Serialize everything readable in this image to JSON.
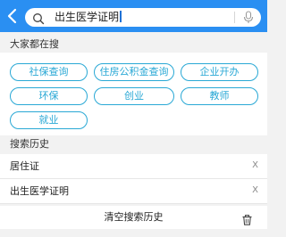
{
  "search": {
    "value": "出生医学证明",
    "back_icon": "chevron-left-icon",
    "search_icon": "search-icon",
    "mic_icon": "microphone-icon"
  },
  "hot": {
    "title": "大家都在搜",
    "tags": [
      "社保查询",
      "住房公积金查询",
      "企业开办",
      "环保",
      "创业",
      "教师",
      "就业"
    ]
  },
  "history": {
    "title": "搜索历史",
    "items": [
      {
        "label": "居住证",
        "remove": "X"
      },
      {
        "label": "出生医学证明",
        "remove": "X"
      }
    ],
    "clear_label": "清空搜索历史",
    "clear_icon": "trash-icon"
  },
  "colors": {
    "header": "#2a8ff2",
    "tag_accent": "#29a8d5",
    "background": "#f2f2f2"
  }
}
